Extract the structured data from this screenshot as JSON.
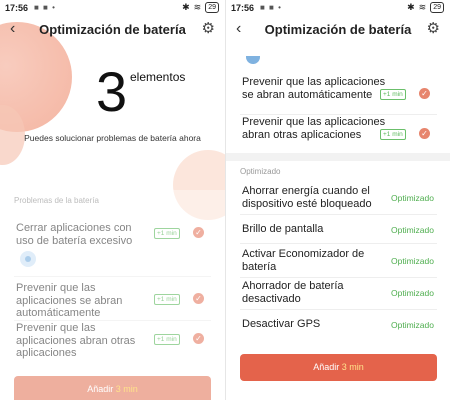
{
  "left": {
    "status": {
      "time": "17:56",
      "notifs": "■ ■ •",
      "battery": "29"
    },
    "title": "Optimización de batería",
    "count": "3",
    "count_label": "elementos",
    "subtitle": "Puedes solucionar problemas de batería ahora",
    "section": "Problemas de la batería",
    "items": [
      {
        "text": "Cerrar aplicaciones con uso de batería excesivo",
        "badge": "+1 min"
      },
      {
        "text": "Prevenir que las aplicaciones se abran automáticamente",
        "badge": "+1 min"
      },
      {
        "text": "Prevenir que las aplicaciones abran otras aplicaciones",
        "badge": "+1 min"
      }
    ],
    "button": {
      "label": "Añadir ",
      "highlight": "3 min"
    }
  },
  "right": {
    "status": {
      "time": "17:56",
      "notifs": "■ ■ •",
      "battery": "29"
    },
    "title": "Optimización de batería",
    "items": [
      {
        "text": "Prevenir que las aplicaciones se abran automáticamente",
        "badge": "+1 min"
      },
      {
        "text": "Prevenir que las aplicaciones abran otras aplicaciones",
        "badge": "+1 min"
      }
    ],
    "section": "Optimizado",
    "optimized": [
      {
        "text": "Ahorrar energía cuando el dispositivo esté bloqueado",
        "status": "Optimizado"
      },
      {
        "text": "Brillo de pantalla",
        "status": "Optimizado"
      },
      {
        "text": "Activar Economizador de batería",
        "status": "Optimizado"
      },
      {
        "text": "Ahorrador de batería desactivado",
        "status": "Optimizado"
      },
      {
        "text": "Desactivar GPS",
        "status": "Optimizado"
      }
    ],
    "button": {
      "label": "Añadir ",
      "highlight": "3 min"
    }
  },
  "icons": {
    "back": "back-arrow-icon",
    "settings": "gear-icon",
    "check": "check-icon"
  },
  "colors": {
    "accent": "#e4634b",
    "badge_green": "#5cb85c",
    "check_red": "#e7856d"
  }
}
